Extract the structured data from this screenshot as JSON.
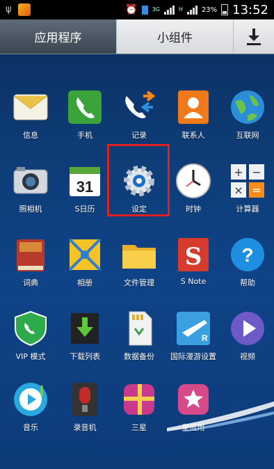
{
  "status_bar": {
    "signal_label": "3G",
    "network_label": "H",
    "battery_percent": "23%",
    "time": "13:52"
  },
  "tabs": {
    "apps": "应用程序",
    "widgets": "小组件",
    "download_icon": "download-icon"
  },
  "apps": [
    {
      "label": "信息",
      "icon": "messages-icon",
      "color": "#f5f1e6"
    },
    {
      "label": "手机",
      "icon": "phone-icon",
      "color": "#3fa13a"
    },
    {
      "label": "记录",
      "icon": "call-log-icon",
      "color": "#ffffff"
    },
    {
      "label": "联系人",
      "icon": "contacts-icon",
      "color": "#f07a1a"
    },
    {
      "label": "互联网",
      "icon": "internet-icon",
      "color": "#2a8ed8"
    },
    {
      "label": "照相机",
      "icon": "camera-icon",
      "color": "#cfd6dc"
    },
    {
      "label": "S日历",
      "icon": "calendar-icon",
      "color": "#ffffff"
    },
    {
      "label": "设定",
      "icon": "settings-gear-icon",
      "color": "#1e6fc8"
    },
    {
      "label": "时钟",
      "icon": "clock-icon",
      "color": "#ffffff"
    },
    {
      "label": "计算器",
      "icon": "calculator-icon",
      "color": "#e9eef2"
    },
    {
      "label": "词典",
      "icon": "dictionary-icon",
      "color": "#c9483a"
    },
    {
      "label": "相册",
      "icon": "gallery-icon",
      "color": "#f5c325"
    },
    {
      "label": "文件管理",
      "icon": "folder-icon",
      "color": "#f5c63a"
    },
    {
      "label": "S Note",
      "icon": "s-note-icon",
      "color": "#d73b2c"
    },
    {
      "label": "帮助",
      "icon": "help-icon",
      "color": "#1e8fe0"
    },
    {
      "label": "VIP 模式",
      "icon": "vip-mode-icon",
      "color": "#2faa4a"
    },
    {
      "label": "下载列表",
      "icon": "download-list-icon",
      "color": "#3d9b2f"
    },
    {
      "label": "数据备份",
      "icon": "backup-sd-icon",
      "color": "#f0f0f0"
    },
    {
      "label": "国际漫游设置",
      "icon": "roaming-icon",
      "color": "#3aa0e0"
    },
    {
      "label": "视频",
      "icon": "video-icon",
      "color": "#6d5ac7"
    },
    {
      "label": "音乐",
      "icon": "music-icon",
      "color": "#29a8e0"
    },
    {
      "label": "录音机",
      "icon": "voice-recorder-icon",
      "color": "#444"
    },
    {
      "label": "三星",
      "icon": "samsung-gift-icon",
      "color": "#c93a8c"
    },
    {
      "label": "星应用",
      "icon": "samsung-apps-icon",
      "color": "#c93a8c"
    }
  ]
}
